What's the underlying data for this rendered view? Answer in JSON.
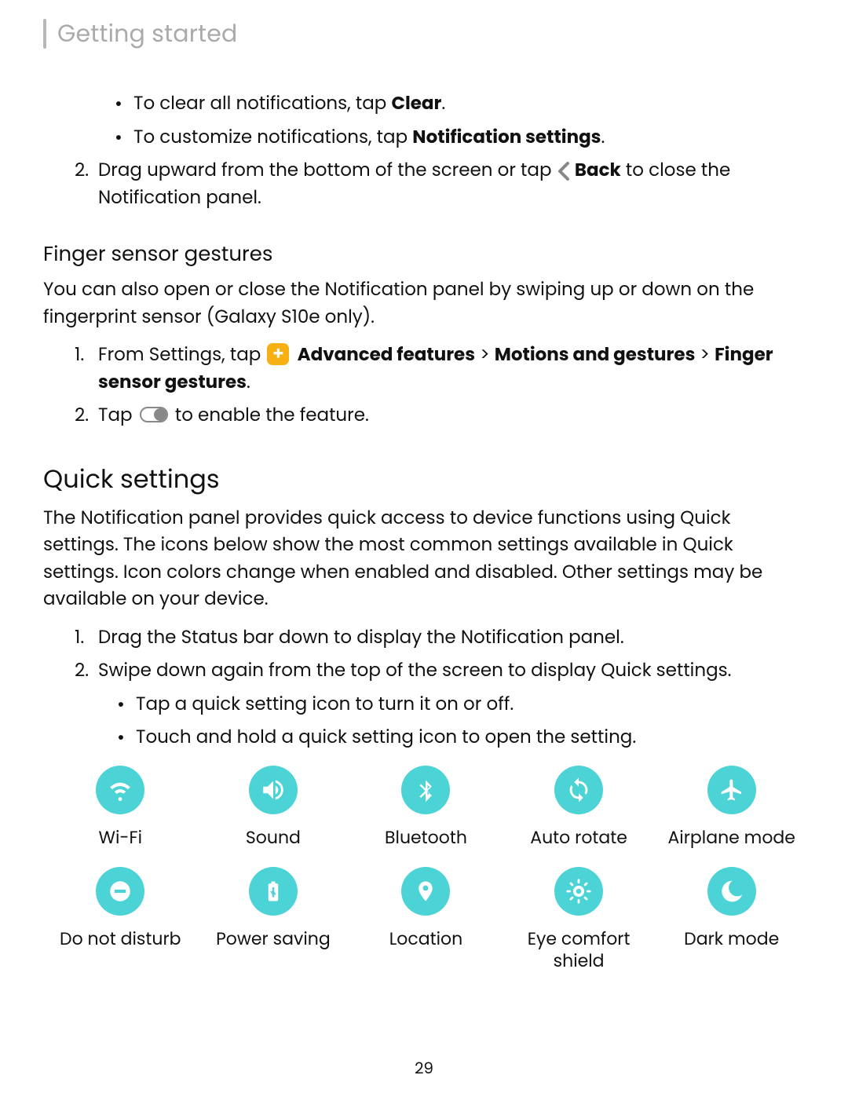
{
  "header": {
    "title": "Getting started"
  },
  "top_bullets": {
    "t1_pre": "To clear all notifications, tap ",
    "t1_bold": "Clear",
    "t1_post": ".",
    "t2_pre": "To customize notifications, tap ",
    "t2_bold": "Notification settings",
    "t2_post": "."
  },
  "step2": {
    "num": "2.",
    "part1": "Drag upward from the bottom of the screen or tap ",
    "bold": "Back",
    "part2": " to close the Notification panel."
  },
  "finger": {
    "heading": "Finger sensor gestures",
    "desc": "You can also open or close the Notification panel by swiping up or down on the fingerprint sensor (Galaxy S10e only).",
    "s1num": "1.",
    "s1_pre": "From Settings, tap ",
    "s1_bold1": "Advanced features",
    "sep1": " > ",
    "s1_bold2": "Motions and gestures",
    "sep2": " > ",
    "s1_bold3": "Finger sensor gestures",
    "s1_post": ".",
    "s2num": "2.",
    "s2_pre": "Tap ",
    "s2_post": " to enable the feature."
  },
  "quick": {
    "heading": "Quick settings",
    "desc": "The Notification panel provides quick access to device functions using Quick settings. The icons below show the most common settings available in Quick settings. Icon colors change when enabled and disabled. Other settings may be available on your device.",
    "s1num": "1.",
    "s1": "Drag the Status bar down to display the Notification panel.",
    "s2num": "2.",
    "s2": "Swipe down again from the top of the screen to display Quick settings.",
    "b1": "Tap a quick setting icon to turn it on or off.",
    "b2": "Touch and hold a quick setting icon to open the setting."
  },
  "qs_icons": {
    "wifi": "Wi-Fi",
    "sound": "Sound",
    "bluetooth": "Bluetooth",
    "rotate": "Auto rotate",
    "airplane": "Airplane mode",
    "dnd": "Do not disturb",
    "power": "Power saving",
    "location": "Location",
    "eye": "Eye comfort shield",
    "dark": "Dark mode"
  },
  "page_number": "29"
}
